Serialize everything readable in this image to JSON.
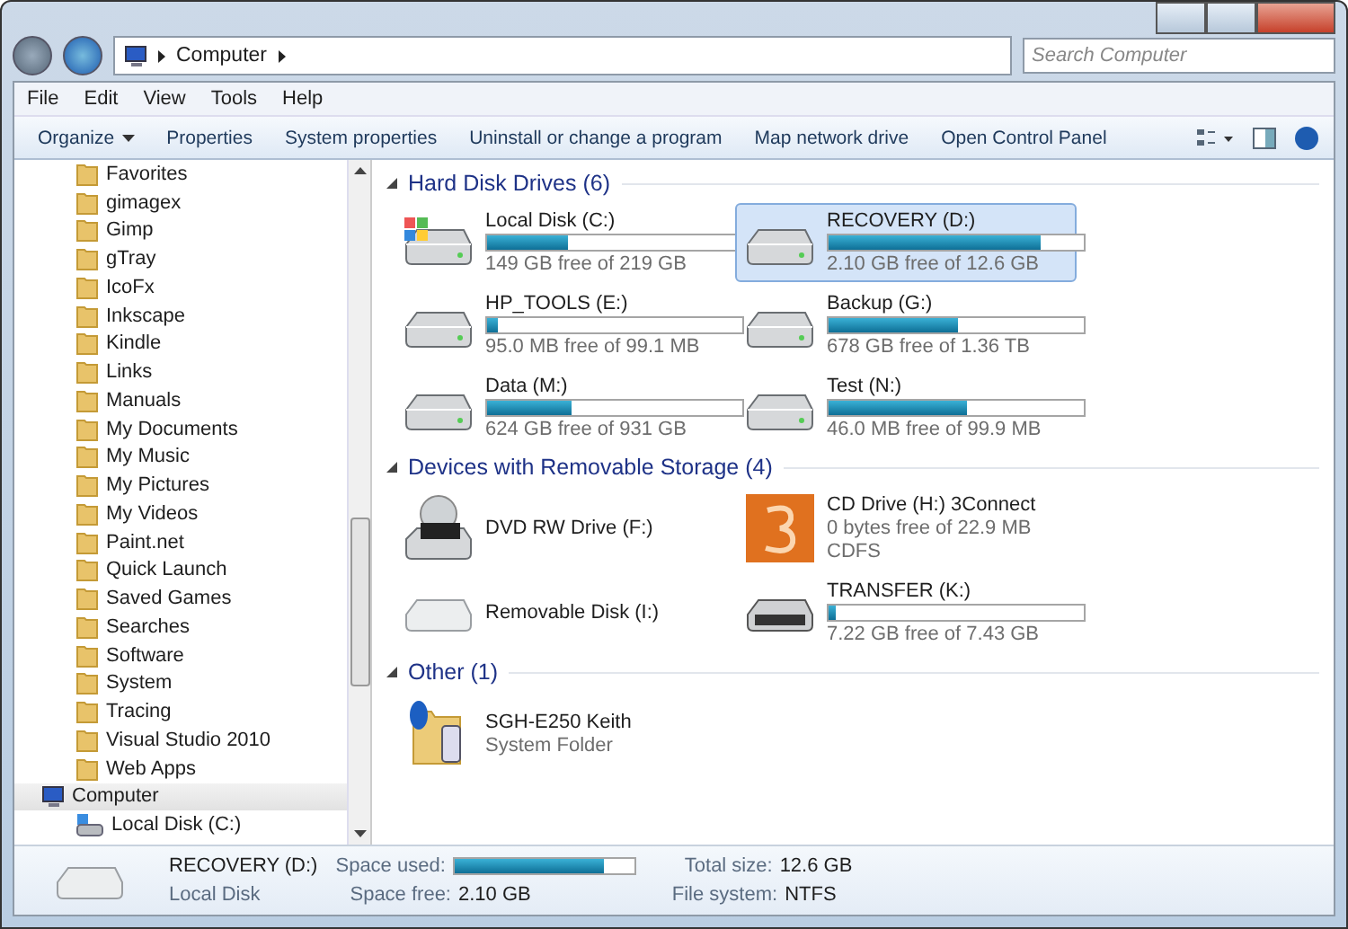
{
  "address_bar": {
    "path": [
      "Computer"
    ]
  },
  "search": {
    "placeholder": "Search Computer"
  },
  "menu": [
    "File",
    "Edit",
    "View",
    "Tools",
    "Help"
  ],
  "toolbar": [
    {
      "label": "Organize",
      "dropdown": true
    },
    {
      "label": "Properties",
      "dropdown": false
    },
    {
      "label": "System properties",
      "dropdown": false
    },
    {
      "label": "Uninstall or change a program",
      "dropdown": false
    },
    {
      "label": "Map network drive",
      "dropdown": false
    },
    {
      "label": "Open Control Panel",
      "dropdown": false
    }
  ],
  "sidebar": {
    "folders": [
      {
        "label": "Favorites"
      },
      {
        "label": "gimagex"
      },
      {
        "label": "Gimp"
      },
      {
        "label": "gTray"
      },
      {
        "label": "IcoFx"
      },
      {
        "label": "Inkscape"
      },
      {
        "label": "Kindle"
      },
      {
        "label": "Links"
      },
      {
        "label": "Manuals"
      },
      {
        "label": "My Documents"
      },
      {
        "label": "My Music"
      },
      {
        "label": "My Pictures"
      },
      {
        "label": "My Videos"
      },
      {
        "label": "Paint.net"
      },
      {
        "label": "Quick Launch"
      },
      {
        "label": "Saved Games"
      },
      {
        "label": "Searches"
      },
      {
        "label": "Software"
      },
      {
        "label": "System"
      },
      {
        "label": "Tracing"
      },
      {
        "label": "Visual Studio 2010"
      },
      {
        "label": "Web Apps"
      }
    ],
    "computer": {
      "label": "Computer",
      "selected": true,
      "children": [
        {
          "label": "Local Disk (C:)",
          "selected": false
        }
      ]
    }
  },
  "groups": [
    {
      "title": "Hard Disk Drives (6)",
      "items": [
        {
          "kind": "system-disk",
          "name": "Local Disk (C:)",
          "level": 0.32,
          "detail": "149 GB free of 219 GB",
          "selected": false
        },
        {
          "kind": "disk",
          "name": "RECOVERY (D:)",
          "level": 0.83,
          "detail": "2.10 GB free of 12.6 GB",
          "selected": true
        },
        {
          "kind": "disk",
          "name": "HP_TOOLS (E:)",
          "level": 0.04,
          "detail": "95.0 MB free of 99.1 MB",
          "selected": false
        },
        {
          "kind": "disk",
          "name": "Backup (G:)",
          "level": 0.51,
          "detail": "678 GB free of 1.36 TB",
          "selected": false
        },
        {
          "kind": "disk",
          "name": "Data (M:)",
          "level": 0.33,
          "detail": "624 GB free of 931 GB",
          "selected": false
        },
        {
          "kind": "disk",
          "name": "Test (N:)",
          "level": 0.54,
          "detail": "46.0 MB free of 99.9 MB",
          "selected": false
        }
      ]
    },
    {
      "title": "Devices with Removable Storage (4)",
      "items": [
        {
          "kind": "dvd",
          "name": "DVD RW Drive (F:)",
          "selected": false
        },
        {
          "kind": "cd-app",
          "name": "CD Drive (H:) 3Connect",
          "detail": "0 bytes free of 22.9 MB",
          "detail2": "CDFS",
          "selected": false
        },
        {
          "kind": "removable",
          "name": "Removable Disk (I:)",
          "selected": false
        },
        {
          "kind": "usb",
          "name": "TRANSFER (K:)",
          "level": 0.03,
          "detail": "7.22 GB free of 7.43 GB",
          "selected": false
        }
      ]
    },
    {
      "title": "Other (1)",
      "items": [
        {
          "kind": "phone-folder",
          "name": "SGH-E250 Keith",
          "detail": "System Folder",
          "selected": false
        }
      ]
    }
  ],
  "details_pane": {
    "name": "RECOVERY (D:)",
    "type": "Local Disk",
    "used_label": "Space used:",
    "level": 0.83,
    "free_label": "Space free:",
    "free": "2.10 GB",
    "total_label": "Total size:",
    "total": "12.6 GB",
    "fs_label": "File system:",
    "fs": "NTFS"
  }
}
